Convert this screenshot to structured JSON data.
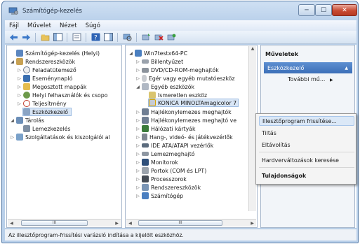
{
  "window": {
    "title": "Számítógép-kezelés"
  },
  "window_controls": {
    "minimize": "─",
    "maximize": "☐",
    "close": "✕"
  },
  "menu": [
    "Fájl",
    "Művelet",
    "Nézet",
    "Súgó"
  ],
  "left_tree": [
    {
      "label": "Számítógép-kezelés (Helyi)",
      "icon": "computer-management-icon",
      "twisty": ""
    },
    {
      "label": "Rendszereszközök",
      "icon": "system-tools-icon",
      "twisty": "◢"
    },
    {
      "label": "Feladatütemező",
      "icon": "task-scheduler-icon",
      "twisty": "▷"
    },
    {
      "label": "Eseménynapló",
      "icon": "event-viewer-icon",
      "twisty": "▷"
    },
    {
      "label": "Megosztott mappák",
      "icon": "shared-folders-icon",
      "twisty": "▷"
    },
    {
      "label": "Helyi felhasználók és csopo",
      "icon": "users-icon",
      "twisty": "▷"
    },
    {
      "label": "Teljesítmény",
      "icon": "performance-icon",
      "twisty": "▷"
    },
    {
      "label": "Eszközkezelő",
      "icon": "device-manager-icon",
      "twisty": ""
    },
    {
      "label": "Tárolás",
      "icon": "storage-icon",
      "twisty": "◢"
    },
    {
      "label": "Lemezkezelés",
      "icon": "disk-management-icon",
      "twisty": ""
    },
    {
      "label": "Szolgáltatások és kiszolgálói al",
      "icon": "services-icon",
      "twisty": "▷"
    }
  ],
  "device_tree": [
    {
      "label": "Win7testx64-PC",
      "icon": "computer-icon",
      "twisty": "◢"
    },
    {
      "label": "Billentyűzet",
      "icon": "keyboard-icon",
      "twisty": "▷"
    },
    {
      "label": "DVD/CD-ROM-meghajtók",
      "icon": "dvd-drive-icon",
      "twisty": "▷"
    },
    {
      "label": "Egér vagy egyéb mutatóeszköz",
      "icon": "mouse-icon",
      "twisty": "▷"
    },
    {
      "label": "Egyéb eszközök",
      "icon": "other-devices-icon",
      "twisty": "◢"
    },
    {
      "label": "Ismeretlen eszköz",
      "icon": "unknown-device-icon",
      "twisty": ""
    },
    {
      "label": "KONICA MINOLTAmagicolor 7",
      "icon": "printer-warning-icon",
      "twisty": ""
    },
    {
      "label": "Hajlékonylemezes meghajtók",
      "icon": "floppy-drive-icon",
      "twisty": "▷"
    },
    {
      "label": "Hajlékonylemezes meghajtó ve",
      "icon": "floppy-controller-icon",
      "twisty": "▷"
    },
    {
      "label": "Hálózati kártyák",
      "icon": "network-adapter-icon",
      "twisty": "▷"
    },
    {
      "label": "Hang-, videó- és játékvezérlők",
      "icon": "sound-icon",
      "twisty": "▷"
    },
    {
      "label": "IDE ATA/ATAPI vezérlők",
      "icon": "ide-controller-icon",
      "twisty": "▷"
    },
    {
      "label": "Lemezmeghajtó",
      "icon": "disk-drive-icon",
      "twisty": "▷"
    },
    {
      "label": "Monitorok",
      "icon": "monitor-icon",
      "twisty": "▷"
    },
    {
      "label": "Portok (COM és LPT)",
      "icon": "port-icon",
      "twisty": "▷"
    },
    {
      "label": "Processzorok",
      "icon": "processor-icon",
      "twisty": "▷"
    },
    {
      "label": "Rendszereszközök",
      "icon": "system-devices-icon",
      "twisty": "▷"
    },
    {
      "label": "Számítógép",
      "icon": "computer-icon",
      "twisty": "▷"
    }
  ],
  "actions": {
    "header": "Műveletek",
    "selected": "Eszközkezelő",
    "more": "További mű..."
  },
  "context_menu": [
    "Illesztőprogram frissítése...",
    "Tiltás",
    "Eltávolítás",
    "Hardverváltozások keresése",
    "Tulajdonságok"
  ],
  "scroll": {
    "grip": "III"
  },
  "status_text": "Az illesztőprogram-frissítési varázsló indítása a kijelölt eszközhöz."
}
